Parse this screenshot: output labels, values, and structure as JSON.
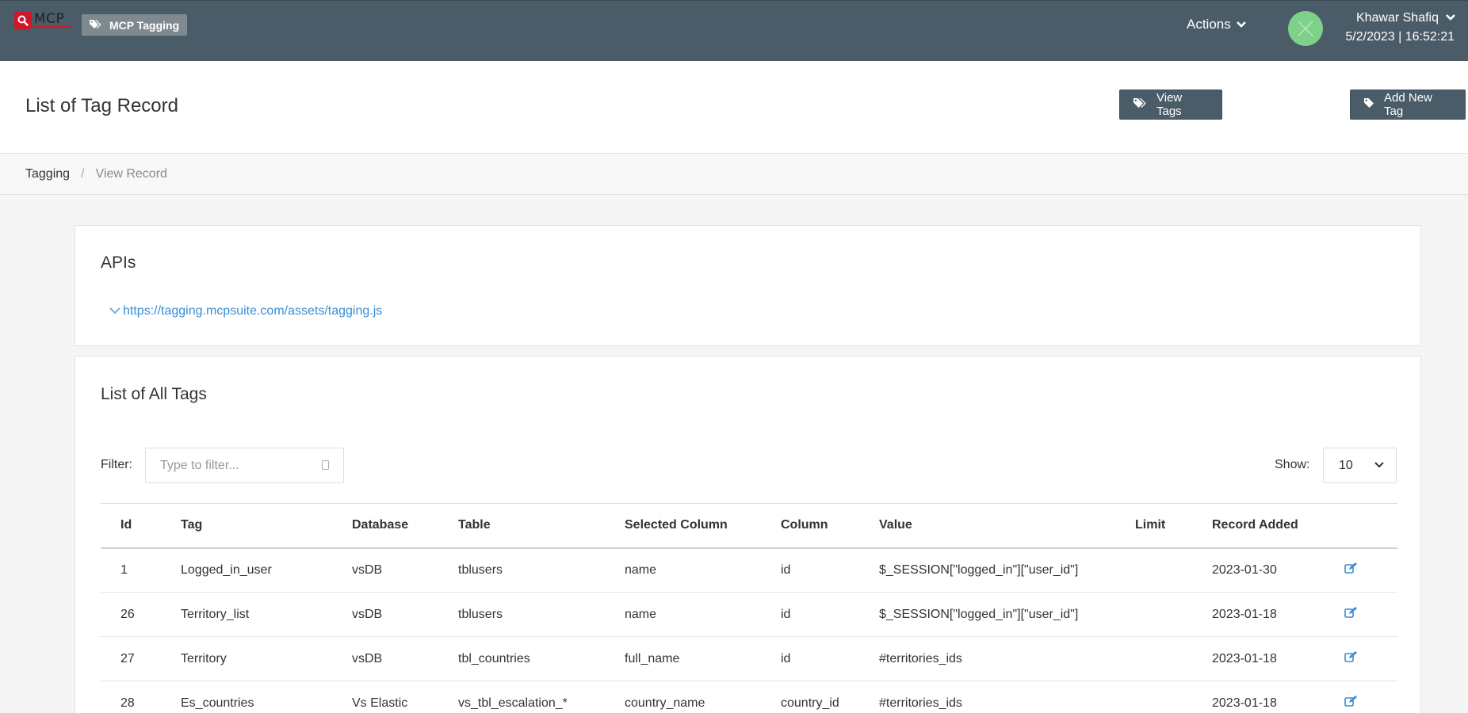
{
  "topbar": {
    "logo_text": "MCP",
    "app_name": "MCP Tagging",
    "actions_label": "Actions",
    "user_name": "Khawar Shafiq",
    "datetime": "5/2/2023 | 16:52:21"
  },
  "header": {
    "title": "List of Tag Record",
    "view_tags_label": "View Tags",
    "add_new_tag_label": "Add New Tag"
  },
  "breadcrumb": {
    "parent": "Tagging",
    "separator": "/",
    "current": "View Record"
  },
  "apis": {
    "title": "APIs",
    "link": "https://tagging.mcpsuite.com/assets/tagging.js"
  },
  "tags": {
    "title": "List of All Tags",
    "filter_label": "Filter:",
    "filter_placeholder": "Type to filter...",
    "show_label": "Show:",
    "show_value": "10",
    "columns": [
      "Id",
      "Tag",
      "Database",
      "Table",
      "Selected Column",
      "Column",
      "Value",
      "Limit",
      "Record Added",
      ""
    ],
    "rows": [
      [
        "1",
        "Logged_in_user",
        "vsDB",
        "tblusers",
        "name",
        "id",
        "$_SESSION[\"logged_in\"][\"user_id\"]",
        "",
        "2023-01-30"
      ],
      [
        "26",
        "Territory_list",
        "vsDB",
        "tblusers",
        "name",
        "id",
        "$_SESSION[\"logged_in\"][\"user_id\"]",
        "",
        "2023-01-18"
      ],
      [
        "27",
        "Territory",
        "vsDB",
        "tbl_countries",
        "full_name",
        "id",
        "#territories_ids",
        "",
        "2023-01-18"
      ],
      [
        "28",
        "Es_countries",
        "Vs Elastic",
        "vs_tbl_escalation_*",
        "country_name",
        "country_id",
        "#territories_ids",
        "",
        "2023-01-18"
      ]
    ]
  },
  "colors": {
    "topbar": "#4a5c67",
    "accent_link": "#3a8dd6",
    "logo_red": "#d0172a",
    "avatar": "#7fd18a"
  }
}
